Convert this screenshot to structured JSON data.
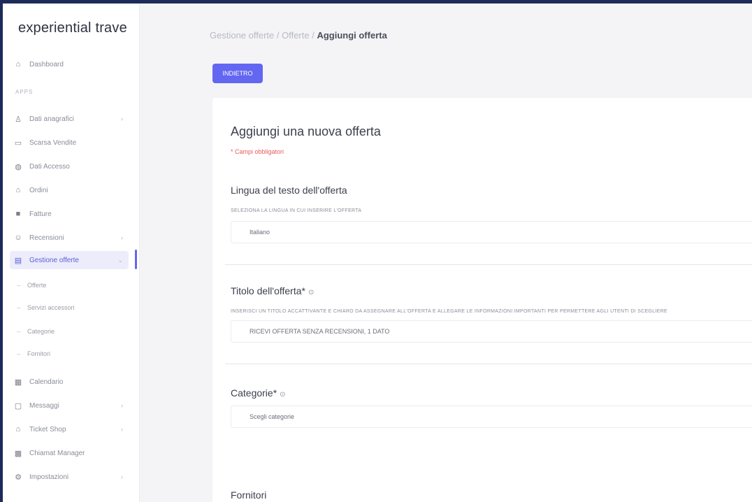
{
  "app": {
    "brand": "experiential trave"
  },
  "sidebar": {
    "dashboard": {
      "label": "Dashboard",
      "icon": "home-icon"
    },
    "section_label": "APPS",
    "items": [
      {
        "label": "Dati anagrafici",
        "icon": "user-icon",
        "has_children": true
      },
      {
        "label": "Scarsa Vendite",
        "icon": "calendar-icon",
        "has_children": false
      },
      {
        "label": "Dati Accesso",
        "icon": "shield-icon",
        "has_children": false
      },
      {
        "label": "Ordini",
        "icon": "bag-icon",
        "has_children": false
      },
      {
        "label": "Fatture",
        "icon": "file-icon",
        "has_children": false
      },
      {
        "label": "Recensioni",
        "icon": "star-icon",
        "has_children": true
      },
      {
        "label": "Gestione offerte",
        "icon": "tag-icon",
        "has_children": true,
        "active": true
      }
    ],
    "sub_items": [
      "Offerte",
      "Servizi accessori",
      "Categorie",
      "Fornitori"
    ],
    "bottom_items": [
      {
        "label": "Calendario",
        "icon": "calendar-icon",
        "has_children": false
      },
      {
        "label": "Messaggi",
        "icon": "message-icon",
        "has_children": true
      },
      {
        "label": "Ticket Shop",
        "icon": "ticket-icon",
        "has_children": true
      },
      {
        "label": "Chiamat Manager",
        "icon": "phone-icon",
        "has_children": false
      },
      {
        "label": "Impostazioni",
        "icon": "gear-icon",
        "has_children": true
      }
    ]
  },
  "breadcrumb": {
    "path": "Gestione offerte / Offerte / ",
    "current": "Aggiungi offerta"
  },
  "toolbar": {
    "back_label": "INDIETRO"
  },
  "form": {
    "title": "Aggiungi una nuova offerta",
    "required_note": "* Campi obbligatori",
    "language": {
      "label": "Lingua del testo dell'offerta",
      "help": "SELEZIONA LA LINGUA IN CUI INSERIRE L'OFFERTA",
      "value": "Italiano"
    },
    "offer_title": {
      "label": "Titolo dell'offerta*",
      "help": "INSERISCI UN TITOLO ACCATTIVANTE E CHIARO DA ASSEGNARE ALL'OFFERTA E ALLEGARE LE INFORMAZIONI IMPORTANTI PER PERMETTERE AGLI UTENTI DI SCEGLIERE",
      "placeholder": "RICEVI OFFERTA SENZA RECENSIONI, 1 DATO"
    },
    "categories": {
      "label": "Categorie*",
      "placeholder": "Scegli categorie"
    },
    "suppliers": {
      "label": "Fornitori"
    }
  }
}
